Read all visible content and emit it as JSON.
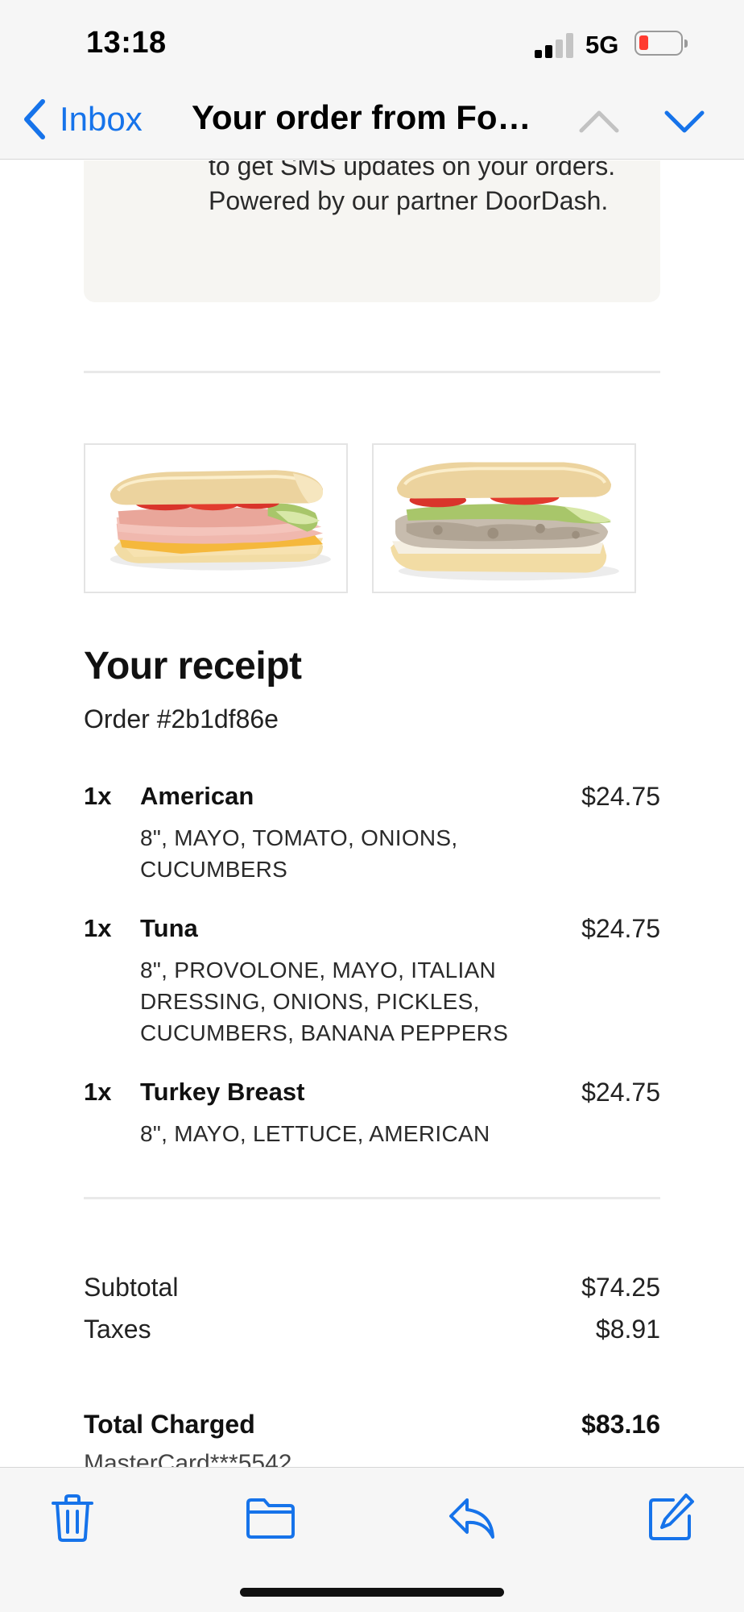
{
  "status_bar": {
    "time": "13:18",
    "network": "5G",
    "accent_color": "#1673ea",
    "battery_color": "#ff3b30"
  },
  "nav": {
    "back_label": "Inbox",
    "title": "Your order from Fo…"
  },
  "sms_card": {
    "text": "to get SMS updates on your orders. Powered by our partner DoorDash."
  },
  "images": [
    {
      "name": "American sandwich photo"
    },
    {
      "name": "Tuna sandwich photo"
    }
  ],
  "receipt": {
    "title": "Your receipt",
    "order_number": "Order #2b1df86e",
    "items": [
      {
        "qty": "1x",
        "name": "American",
        "price": "$24.75",
        "mods": "8\", MAYO, TOMATO, ONIONS, CUCUMBERS"
      },
      {
        "qty": "1x",
        "name": "Tuna",
        "price": "$24.75",
        "mods": "8\", PROVOLONE, MAYO, ITALIAN DRESSING, ONIONS, PICKLES, CUCUMBERS, BANANA PEPPERS"
      },
      {
        "qty": "1x",
        "name": "Turkey Breast",
        "price": "$24.75",
        "mods": "8\", MAYO, LETTUCE, AMERICAN"
      }
    ],
    "subtotal_label": "Subtotal",
    "subtotal_value": "$74.25",
    "taxes_label": "Taxes",
    "taxes_value": "$8.91",
    "total_label": "Total Charged",
    "total_value": "$83.16",
    "payment": "MasterCard***5542"
  },
  "toolbar": {
    "icons": [
      "trash-icon",
      "folder-icon",
      "reply-icon",
      "compose-icon"
    ]
  }
}
